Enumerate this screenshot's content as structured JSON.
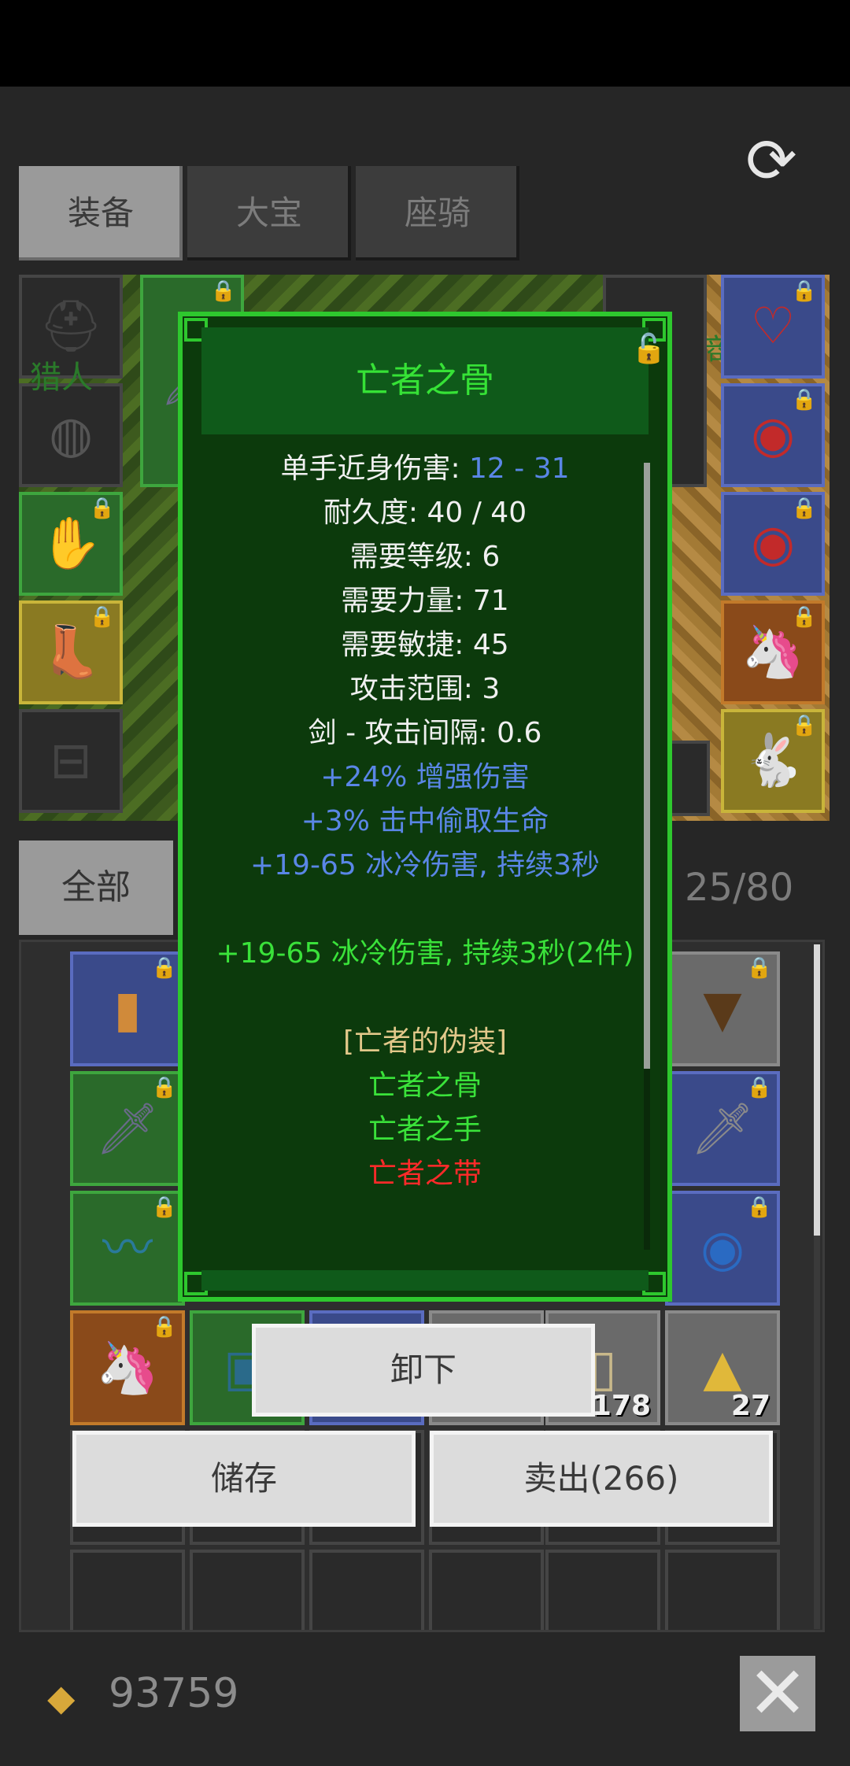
{
  "tabs": [
    "装备",
    "大宝",
    "座骑"
  ],
  "filter": {
    "all_label": "全部",
    "capacity": "25/80"
  },
  "tooltip": {
    "title": "亡者之骨",
    "lines": [
      {
        "label": "单手近身伤害: ",
        "value": "12 - 31"
      },
      {
        "text": "耐久度: 40 / 40"
      },
      {
        "text": "需要等级: 6"
      },
      {
        "text": "需要力量: 71"
      },
      {
        "text": "需要敏捷: 45"
      },
      {
        "text": "攻击范围: 3"
      },
      {
        "text": "剑 - 攻击间隔: 0.6"
      },
      {
        "text": "+24% 增强伤害"
      },
      {
        "text": "+3% 击中偷取生命"
      },
      {
        "text": "+19-65 冰冷伤害, 持续3秒"
      },
      {
        "text": "+19-65 冰冷伤害, 持续3秒(2件)"
      },
      {
        "text": "[亡者的伪装]"
      },
      {
        "text": "亡者之骨"
      },
      {
        "text": "亡者之手"
      },
      {
        "text": "亡者之带"
      }
    ],
    "colors": {
      "stat_value": "#5a86e6",
      "magic": "#5a86e6",
      "set_bonus": "#3ae23a",
      "set_name": "#e2c88a",
      "owned": "#3ae23a",
      "missing": "#ff2a2a",
      "border": "#2ec82e"
    }
  },
  "actions": {
    "unequip": "卸下",
    "store": "储存",
    "sell": "卖出(266)"
  },
  "inventory": {
    "counts": [
      "178",
      "27"
    ]
  },
  "gold": "93759",
  "icons": {
    "refresh": "refresh-icon",
    "close": "close-icon",
    "lock": "lock-icon",
    "gold": "gold-pile-icon"
  },
  "background_labels": [
    "猎人",
    "宝商"
  ]
}
